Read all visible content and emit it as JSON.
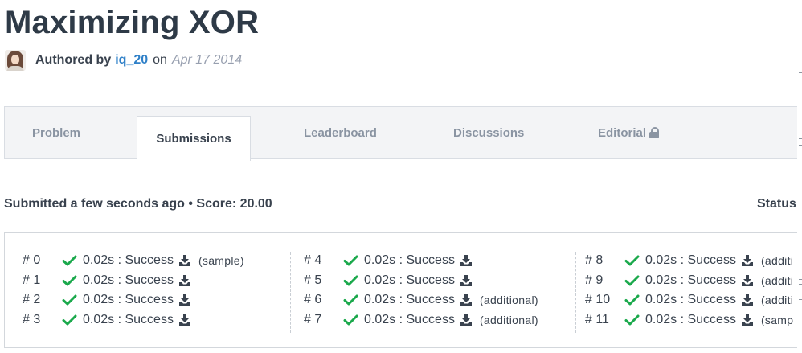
{
  "header": {
    "title": "Maximizing XOR",
    "authored_label": "Authored by",
    "author": "iq_20",
    "on_word": "on",
    "date": "Apr 17 2014"
  },
  "tabs": [
    {
      "label": "Problem",
      "active": false
    },
    {
      "label": "Submissions",
      "active": true
    },
    {
      "label": "Leaderboard",
      "active": false
    },
    {
      "label": "Discussions",
      "active": false
    },
    {
      "label": "Editorial",
      "active": false,
      "locked": true
    }
  ],
  "summary": {
    "text": "Submitted a few seconds ago • Score: 20.00",
    "status_label": "Status"
  },
  "colors": {
    "success": "#1ba94c",
    "link": "#2f80c8",
    "text": "#39424e",
    "muted": "#8a94a2"
  },
  "icons": {
    "pass": "check-icon",
    "download": "download-icon",
    "locked": "lock-icon"
  },
  "testcases": [
    [
      {
        "num": "# 0",
        "result": "0.02s : Success",
        "tag": "(sample)"
      },
      {
        "num": "# 1",
        "result": "0.02s : Success",
        "tag": ""
      },
      {
        "num": "# 2",
        "result": "0.02s : Success",
        "tag": ""
      },
      {
        "num": "# 3",
        "result": "0.02s : Success",
        "tag": ""
      }
    ],
    [
      {
        "num": "# 4",
        "result": "0.02s : Success",
        "tag": ""
      },
      {
        "num": "# 5",
        "result": "0.02s : Success",
        "tag": ""
      },
      {
        "num": "# 6",
        "result": "0.02s : Success",
        "tag": "(additional)"
      },
      {
        "num": "# 7",
        "result": "0.02s : Success",
        "tag": "(additional)"
      }
    ],
    [
      {
        "num": "# 8",
        "result": "0.02s : Success",
        "tag": "(additi"
      },
      {
        "num": "# 9",
        "result": "0.02s : Success",
        "tag": "(additi"
      },
      {
        "num": "# 10",
        "result": "0.02s : Success",
        "tag": "(additi"
      },
      {
        "num": "# 11",
        "result": "0.02s : Success",
        "tag": "(samp"
      }
    ]
  ]
}
